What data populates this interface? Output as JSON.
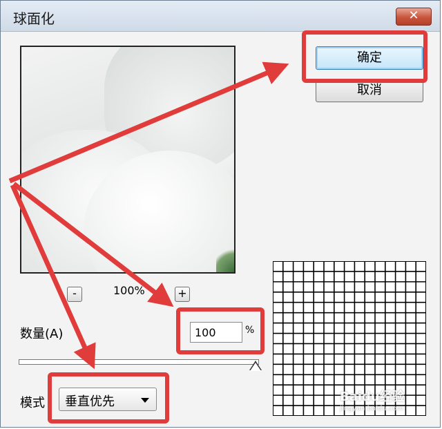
{
  "window": {
    "title": "球面化",
    "close_symbol": "✕"
  },
  "preview": {
    "zoom_out_label": "-",
    "zoom_in_label": "+",
    "zoom_level": "100%"
  },
  "amount": {
    "label": "数量(A)",
    "value": "100",
    "unit": "%",
    "slider_fraction": 1.0
  },
  "mode": {
    "label": "模式",
    "selected": "垂直优先"
  },
  "buttons": {
    "ok": "确定",
    "cancel": "取消"
  },
  "grid": {
    "rows": 15,
    "cols": 15
  },
  "watermark": {
    "text": "Baidu经验",
    "sub": "jingyan.baidu.com"
  },
  "annotation": {
    "color": "#e03c3c"
  },
  "icons": {
    "close": "close-icon",
    "dropdown": "chevron-down-icon"
  }
}
